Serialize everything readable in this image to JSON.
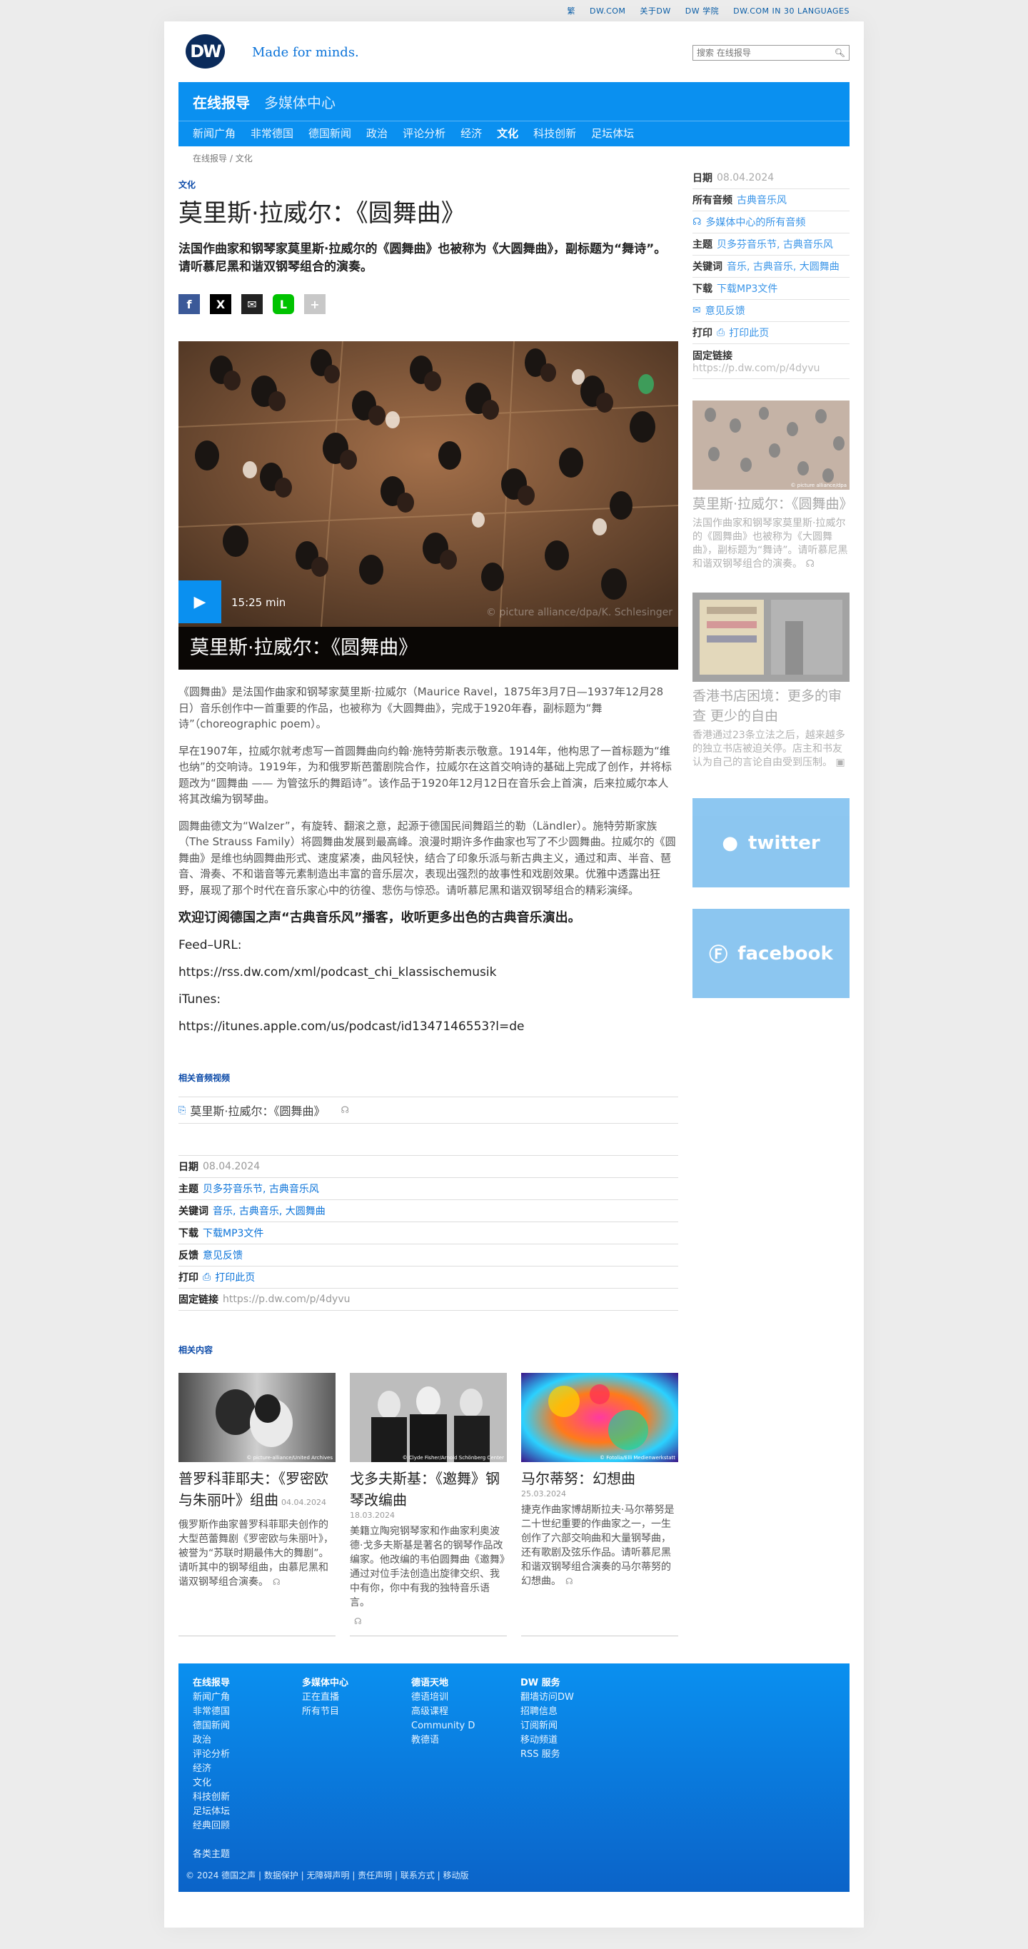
{
  "topbar": {
    "links": [
      "繁",
      "DW.COM",
      "关于DW",
      "DW 学院",
      "DW.COM IN 30 LANGUAGES"
    ]
  },
  "header": {
    "logo": "DW",
    "tagline": "Made for minds.",
    "search_placeholder": "搜索 在线报导"
  },
  "nav": {
    "primary": "在线报导",
    "secondary": "多媒体中心",
    "items": [
      "新闻广角",
      "非常德国",
      "德国新闻",
      "政治",
      "评论分析",
      "经济",
      "文化",
      "科技创新",
      "足坛体坛"
    ],
    "active": "文化"
  },
  "breadcrumb": [
    "在线报导",
    "/",
    "文化"
  ],
  "article": {
    "kicker": "文化",
    "title": "莫里斯·拉威尔：《圆舞曲》",
    "teaser": "法国作曲家和钢琴家莫里斯·拉威尔的《圆舞曲》也被称为《大圆舞曲》，副标题为“舞诗”。请听慕尼黑和谐双钢琴组合的演奏。",
    "share": [
      "f",
      "X",
      "✉",
      "L",
      "+"
    ],
    "media": {
      "duration": "15:25 min",
      "caption": "莫里斯·拉威尔：《圆舞曲》",
      "credit": "© picture alliance/dpa/K. Schlesinger"
    },
    "paragraphs": [
      "《圆舞曲》是法国作曲家和钢琴家莫里斯·拉威尔（Maurice Ravel，1875年3月7日—1937年12月28日）音乐创作中一首重要的作品，也被称为《大圆舞曲》，完成于1920年春，副标题为“舞诗”（choreographic poem）。",
      "早在1907年，拉威尔就考虑写一首圆舞曲向约翰·施特劳斯表示敬意。1914年，他构思了一首标题为“维也纳”的交响诗。1919年，为和俄罗斯芭蕾剧院合作，拉威尔在这首交响诗的基础上完成了创作，并将标题改为“圆舞曲 —— 为管弦乐的舞蹈诗”。该作品于1920年12月12日在音乐会上首演，后来拉威尔本人将其改编为钢琴曲。",
      "圆舞曲德文为“Walzer”，有旋转、翻滚之意，起源于德国民间舞蹈兰的勒（Ländler）。施特劳斯家族（The Strauss Family）将圆舞曲发展到最高峰。浪漫时期许多作曲家也写了不少圆舞曲。拉威尔的《圆舞曲》是维也纳圆舞曲形式、速度紧凑，曲风轻快，结合了印象乐派与新古典主义，通过和声、半音、琶音、滑奏、不和谐音等元素制造出丰富的音乐层次，表现出强烈的故事性和戏剧效果。优雅中透露出狂野，展现了那个时代在音乐家心中的彷徨、悲伤与惊恐。请听慕尼黑和谐双钢琴组合的精彩演绎。"
    ],
    "subscribe": "欢迎订阅德国之声“古典音乐风”播客，收听更多出色的古典音乐演出。",
    "feed_label": "Feed–URL:",
    "feed_url": "https://rss.dw.com/xml/podcast_chi_klassischemusik",
    "itunes_label": "iTunes:",
    "itunes_url": "https://itunes.apple.com/us/podcast/id1347146553?l=de"
  },
  "related_av": {
    "label": "相关音频视频",
    "item": "莫里斯·拉威尔：《圆舞曲》"
  },
  "meta": {
    "date_label": "日期",
    "date": "08.04.2024",
    "topic_label": "主题",
    "topic": "贝多芬音乐节, 古典音乐风",
    "keywords_label": "关键词",
    "keywords": "音乐, 古典音乐, 大圆舞曲",
    "download_label": "下载",
    "download": "下载MP3文件",
    "feedback_label": "反馈",
    "feedback": "意见反馈",
    "print_label": "打印",
    "print": "打印此页",
    "permalink_label": "固定链接",
    "permalink": "https://p.dw.com/p/4dyvu"
  },
  "related": {
    "label": "相关内容",
    "cards": [
      {
        "title": "普罗科菲耶夫：《罗密欧与朱丽叶》组曲",
        "date": "04.04.2024",
        "text": "俄罗斯作曲家普罗科菲耶夫创作的大型芭蕾舞剧《罗密欧与朱丽叶》，被誉为“苏联时期最伟大的舞剧”。请听其中的钢琴组曲，由慕尼黑和谐双钢琴组合演奏。",
        "credit": "© picture-alliance/United Archives"
      },
      {
        "title": "戈多夫斯基：《邀舞》钢琴改编曲",
        "date": "18.03.2024",
        "text": "美籍立陶宛钢琴家和作曲家利奥波德·戈多夫斯基是著名的钢琴作品改编家。他改编的韦伯圆舞曲《邀舞》通过对位手法创造出旋律交织、我中有你，你中有我的独特音乐语言。",
        "credit": "© Clyde Fisher/Arnold Schönberg Center"
      },
      {
        "title": "马尔蒂努：幻想曲",
        "date": "25.03.2024",
        "text": "捷克作曲家博胡斯拉夫·马尔蒂努是二十世纪重要的作曲家之一，一生创作了六部交响曲和大量钢琴曲，还有歌剧及弦乐作品。请听慕尼黑和谐双钢琴组合演奏的马尔蒂努的幻想曲。",
        "credit": "© Fotolia/Elli Medienwerkstatt"
      }
    ]
  },
  "sidebar": {
    "date_label": "日期",
    "date": "08.04.2024",
    "all_audio_label": "所有音频",
    "all_audio": "古典音乐风",
    "media_center": "多媒体中心的所有音频",
    "topic_label": "主题",
    "topic": "贝多芬音乐节, 古典音乐风",
    "keywords_label": "关键词",
    "keywords": "音乐, 古典音乐, 大圆舞曲",
    "download_label": "下载",
    "download": "下载MP3文件",
    "feedback": "意见反馈",
    "print_label": "打印",
    "print": "打印此页",
    "permalink_label": "固定链接",
    "permalink": "https://p.dw.com/p/4dyvu",
    "card1": {
      "title": "莫里斯·拉威尔：《圆舞曲》",
      "text": "法国作曲家和钢琴家莫里斯·拉威尔的《圆舞曲》也被称为《大圆舞曲》，副标题为“舞诗”。请听慕尼黑和谐双钢琴组合的演奏。",
      "credit": "© picture alliance/dpa"
    },
    "card2": {
      "title": "香港书店困境：更多的审查 更少的自由",
      "text": "香港通过23条立法之后，越来越多的独立书店被迫关停。店主和书友认为自己的言论自由受到压制。"
    },
    "twitter": "twitter",
    "facebook": "facebook"
  },
  "footer": {
    "col1_title": "在线报导",
    "col1": [
      "新闻广角",
      "非常德国",
      "德国新闻",
      "政治",
      "评论分析",
      "经济",
      "文化",
      "科技创新",
      "足坛体坛",
      "经典回顾"
    ],
    "col2_title": "多媒体中心",
    "col2": [
      "正在直播",
      "所有节目"
    ],
    "col3_title": "德语天地",
    "col3": [
      "德语培训",
      "高级课程",
      "Community D",
      "教德语"
    ],
    "col4_title": "DW 服务",
    "col4": [
      "翻墙访问DW",
      "招聘信息",
      "订阅新闻",
      "移动频道",
      "RSS 服务"
    ],
    "topics": "各类主题",
    "bottom": "© 2024 德国之声 | 数据保护 | 无障碍声明 | 责任声明 | 联系方式 | 移动版"
  },
  "colors": {
    "accent": "#0a90f0",
    "link": "#0b73d9",
    "logo": "#0b2b5b"
  }
}
